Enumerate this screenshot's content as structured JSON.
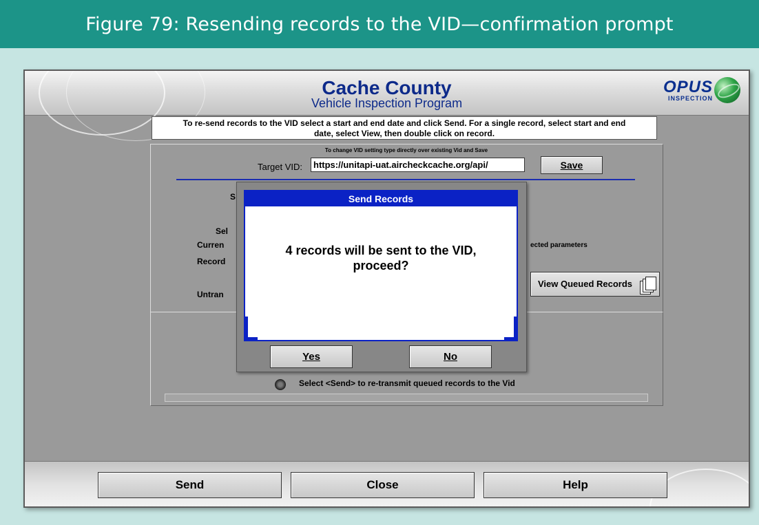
{
  "figure": {
    "caption": "Figure 79: Resending records to the VID—confirmation prompt"
  },
  "app": {
    "brand_title": "Cache County",
    "brand_subtitle": "Vehicle Inspection Program",
    "logo_text": "OPUS",
    "logo_subtext": "INSPECTION"
  },
  "instructions": {
    "line1": "To re-send records to the VID select a start and end date and click Send. For a single record, select start and end",
    "line2": "date, select View, then double click on record."
  },
  "vid": {
    "change_note": "To change VID setting type directly over existing Vid and Save",
    "target_label": "Target VID:",
    "target_value": "https://unitapi-uat.aircheckcache.org/api/",
    "save_label": "Save"
  },
  "partial_labels": {
    "s": "S",
    "sel": "Sel",
    "curr": "Curren",
    "record": "Record",
    "untran": "Untran",
    "parameters": "ected parameters"
  },
  "view_queued_label": "View Queued Records",
  "send_hint": "Select <Send> to re-transmit queued records to the Vid",
  "bottom_buttons": {
    "send": "Send",
    "close": "Close",
    "help": "Help"
  },
  "dialog": {
    "title": "Send Records",
    "message_line1": "4 records will be sent to the VID,",
    "message_line2": "proceed?",
    "yes": "Yes",
    "no": "No"
  }
}
